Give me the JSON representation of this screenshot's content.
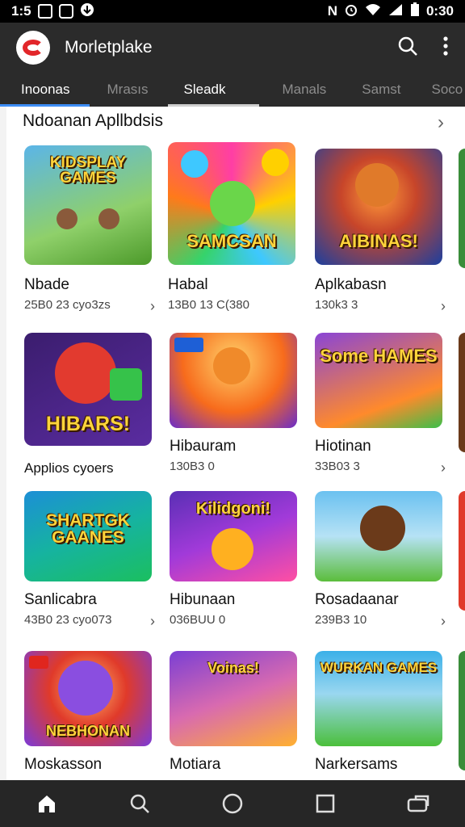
{
  "status_bar": {
    "time_left": "1:5",
    "time_right": "0:30",
    "n_label": "N"
  },
  "app_bar": {
    "title": "Morletplake",
    "icons": [
      "search-icon",
      "more-vert-icon"
    ]
  },
  "tabs": [
    {
      "label": "Inoonas"
    },
    {
      "label": "Mrasıs"
    },
    {
      "label": "Sleadk"
    },
    {
      "label": "Manals"
    },
    {
      "label": "Samst"
    },
    {
      "label": "Soco"
    }
  ],
  "section": {
    "title": "Ndoanan Apllbdsis"
  },
  "apps": [
    {
      "name": "Nbade",
      "meta": "25B0 23 cyo3zs",
      "art_text": "KIDSPLAY GAMES",
      "colors": [
        "#5bb5e8",
        "#4c9a2a"
      ]
    },
    {
      "name": "Habal",
      "meta": "13B0 13 C(380",
      "art_text": "SAMCSAN",
      "colors": [
        "#ff3ea5",
        "#ffd000"
      ]
    },
    {
      "name": "Aplkabasn",
      "meta": "130k3 3",
      "art_text": "AIBINAS!",
      "colors": [
        "#1b3fa0",
        "#ff7a1a"
      ]
    },
    {
      "name": "Applios cyoers",
      "meta": "",
      "art_text": "HIBARS!",
      "colors": [
        "#3b1d6e",
        "#e23a2f"
      ]
    },
    {
      "name": "Hibauram",
      "meta": "130B3 0",
      "art_text": "",
      "colors": [
        "#f76b1c",
        "#6a2cc9"
      ]
    },
    {
      "name": "Hiotinan",
      "meta": "33B03 3",
      "art_text": "Some HAMES",
      "colors": [
        "#8a45d6",
        "#ff8a2b"
      ]
    },
    {
      "name": "Sanlicabra",
      "meta": "43B0 23 cyo073",
      "art_text": "SHARTGK GAANES",
      "colors": [
        "#1c8fd6",
        "#1bbf5f"
      ]
    },
    {
      "name": "Hibunaan",
      "meta": "036BUU 0",
      "art_text": "Kilidgoni!",
      "colors": [
        "#5a2fb5",
        "#ff4fa3"
      ]
    },
    {
      "name": "Rosadaanar",
      "meta": "239B3 10",
      "art_text": "",
      "colors": [
        "#6bc1f0",
        "#5bbd3b"
      ]
    },
    {
      "name": "Moskasson",
      "meta": "",
      "art_text": "NEBHONAN",
      "colors": [
        "#e03a2a",
        "#7b3ad9"
      ]
    },
    {
      "name": "Motiara",
      "meta": "",
      "art_text": "Voinas!",
      "colors": [
        "#7a3fd4",
        "#ffb030"
      ]
    },
    {
      "name": "Narkersams",
      "meta": "",
      "art_text": "WURKAN GAMES",
      "colors": [
        "#3bb0e8",
        "#4bbf3b"
      ]
    }
  ],
  "nav_bar": {
    "icons": [
      "home-icon",
      "search-icon",
      "circle-icon",
      "square-icon",
      "recent-icon"
    ]
  },
  "colors": {
    "app_bar": "#2b2b2b",
    "tab_indicator": "#3d8df5",
    "background": "#ffffff"
  }
}
